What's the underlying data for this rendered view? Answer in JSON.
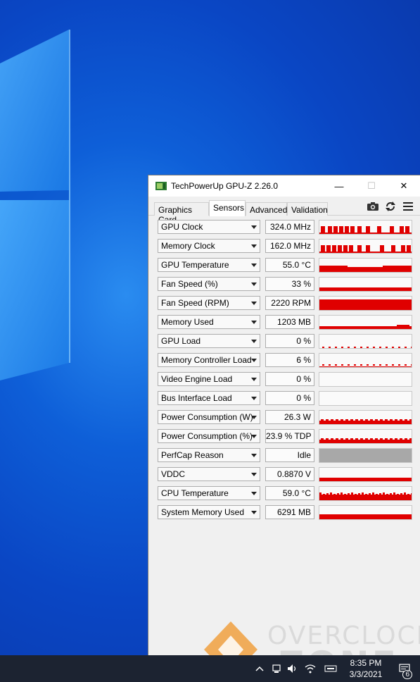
{
  "window": {
    "title": "TechPowerUp GPU-Z 2.26.0",
    "minimize_glyph": "—",
    "maximize_glyph": "☐",
    "close_glyph": "✕"
  },
  "tabs": [
    {
      "label": "Graphics Card",
      "active": false
    },
    {
      "label": "Sensors",
      "active": true
    },
    {
      "label": "Advanced",
      "active": false
    },
    {
      "label": "Validation",
      "active": false
    }
  ],
  "toolbar_icons": [
    "camera-icon",
    "refresh-icon",
    "menu-icon"
  ],
  "sensors": [
    {
      "label": "GPU Clock",
      "value": "324.0 MHz",
      "graph": "clock"
    },
    {
      "label": "Memory Clock",
      "value": "162.0 MHz",
      "graph": "clock2"
    },
    {
      "label": "GPU Temperature",
      "value": "55.0 °C",
      "graph": "temp"
    },
    {
      "label": "Fan Speed (%)",
      "value": "33 %",
      "graph": "low"
    },
    {
      "label": "Fan Speed (RPM)",
      "value": "2220 RPM",
      "graph": "high"
    },
    {
      "label": "Memory Used",
      "value": "1203 MB",
      "graph": "mem"
    },
    {
      "label": "GPU Load",
      "value": "0 %",
      "graph": "dots"
    },
    {
      "label": "Memory Controller Load",
      "value": "6 %",
      "graph": "dots2"
    },
    {
      "label": "Video Engine Load",
      "value": "0 %",
      "graph": "none"
    },
    {
      "label": "Bus Interface Load",
      "value": "0 %",
      "graph": "none"
    },
    {
      "label": "Power Consumption (W)",
      "value": "26.3 W",
      "graph": "power"
    },
    {
      "label": "Power Consumption (%)",
      "value": "23.9 % TDP",
      "graph": "power"
    },
    {
      "label": "PerfCap Reason",
      "value": "Idle",
      "graph": "gray"
    },
    {
      "label": "VDDC",
      "value": "0.8870 V",
      "graph": "vddc"
    },
    {
      "label": "CPU Temperature",
      "value": "59.0 °C",
      "graph": "cpu"
    },
    {
      "label": "System Memory Used",
      "value": "6291 MB",
      "graph": "sys"
    }
  ],
  "taskbar": {
    "time": "8:35 PM",
    "date": "3/3/2021",
    "notification_count": "6"
  },
  "watermark": {
    "line1": "OVERCLOCK",
    "line2": "ZONE"
  },
  "colors": {
    "graph_red": "#e00000",
    "graph_gray": "#a8a8a8",
    "taskbar": "#1c2331"
  }
}
